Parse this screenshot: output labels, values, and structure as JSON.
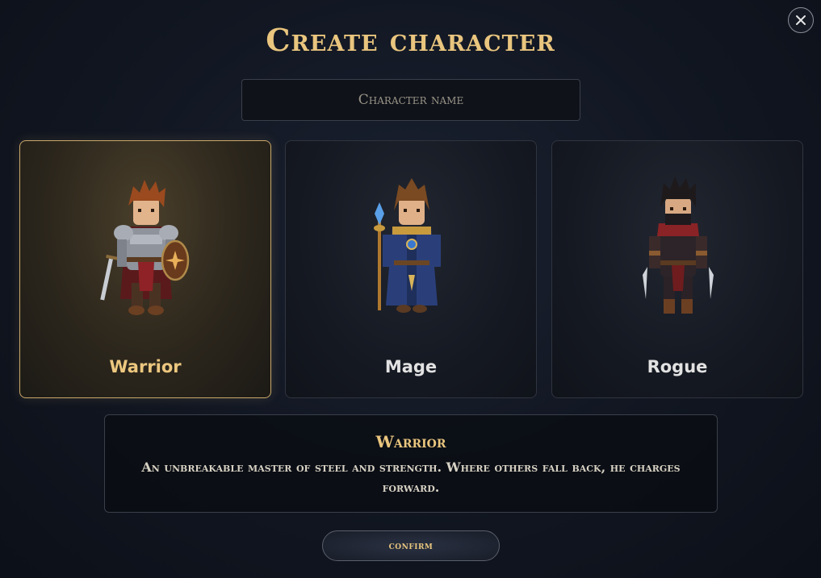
{
  "header": {
    "title": "Create character",
    "close_icon": "close-icon"
  },
  "name_field": {
    "placeholder": "Character name",
    "value": ""
  },
  "classes": [
    {
      "label": "Warrior",
      "selected": true,
      "icon": "warrior-sprite"
    },
    {
      "label": "Mage",
      "selected": false,
      "icon": "mage-sprite"
    },
    {
      "label": "Rogue",
      "selected": false,
      "icon": "rogue-sprite"
    }
  ],
  "description": {
    "title": "Warrior",
    "text": "An unbreakable master of steel and strength. Where others fall back, he charges forward."
  },
  "actions": {
    "confirm_label": "confirm"
  },
  "colors": {
    "accent_gold": "#e9c57e",
    "selected_border": "#c9a86a",
    "background": "#111621"
  }
}
